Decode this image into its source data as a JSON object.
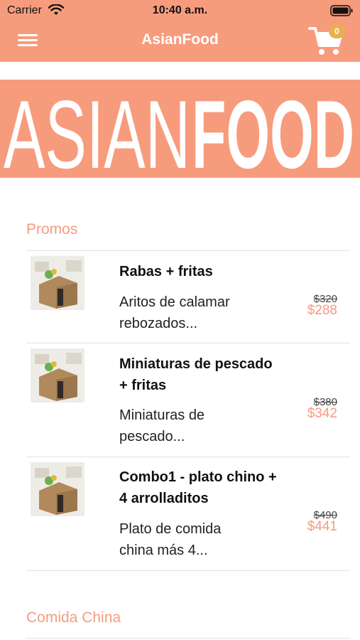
{
  "status": {
    "carrier": "Carrier",
    "time": "10:40 a.m."
  },
  "nav": {
    "title": "AsianFood",
    "cart_count": "0"
  },
  "banner": {
    "word1": "ASIAN",
    "word2": "FOOD"
  },
  "sections": [
    {
      "title": "Promos"
    },
    {
      "title": "Comida China"
    }
  ],
  "promos": [
    {
      "name_line1": "Rabas + fritas",
      "name_line2": "",
      "desc_line1": "Aritos de calamar",
      "desc_line2": "rebozados...",
      "price_old": "$320",
      "price_new": "$288"
    },
    {
      "name_line1": "Miniaturas de pescado",
      "name_line2": "+ fritas",
      "desc_line1": "Miniaturas de",
      "desc_line2": "pescado...",
      "price_old": "$380",
      "price_new": "$342"
    },
    {
      "name_line1": "Combo1 - plato chino +",
      "name_line2": "4 arrolladitos",
      "desc_line1": "Plato de comida",
      "desc_line2": "china más 4...",
      "price_old": "$490",
      "price_new": "$441"
    }
  ],
  "colors": {
    "accent": "#F79B7D",
    "badge": "#E9B04F"
  },
  "icons": {
    "menu": "hamburger-icon",
    "cart": "cart-icon",
    "wifi": "wifi-icon",
    "battery": "battery-icon"
  }
}
